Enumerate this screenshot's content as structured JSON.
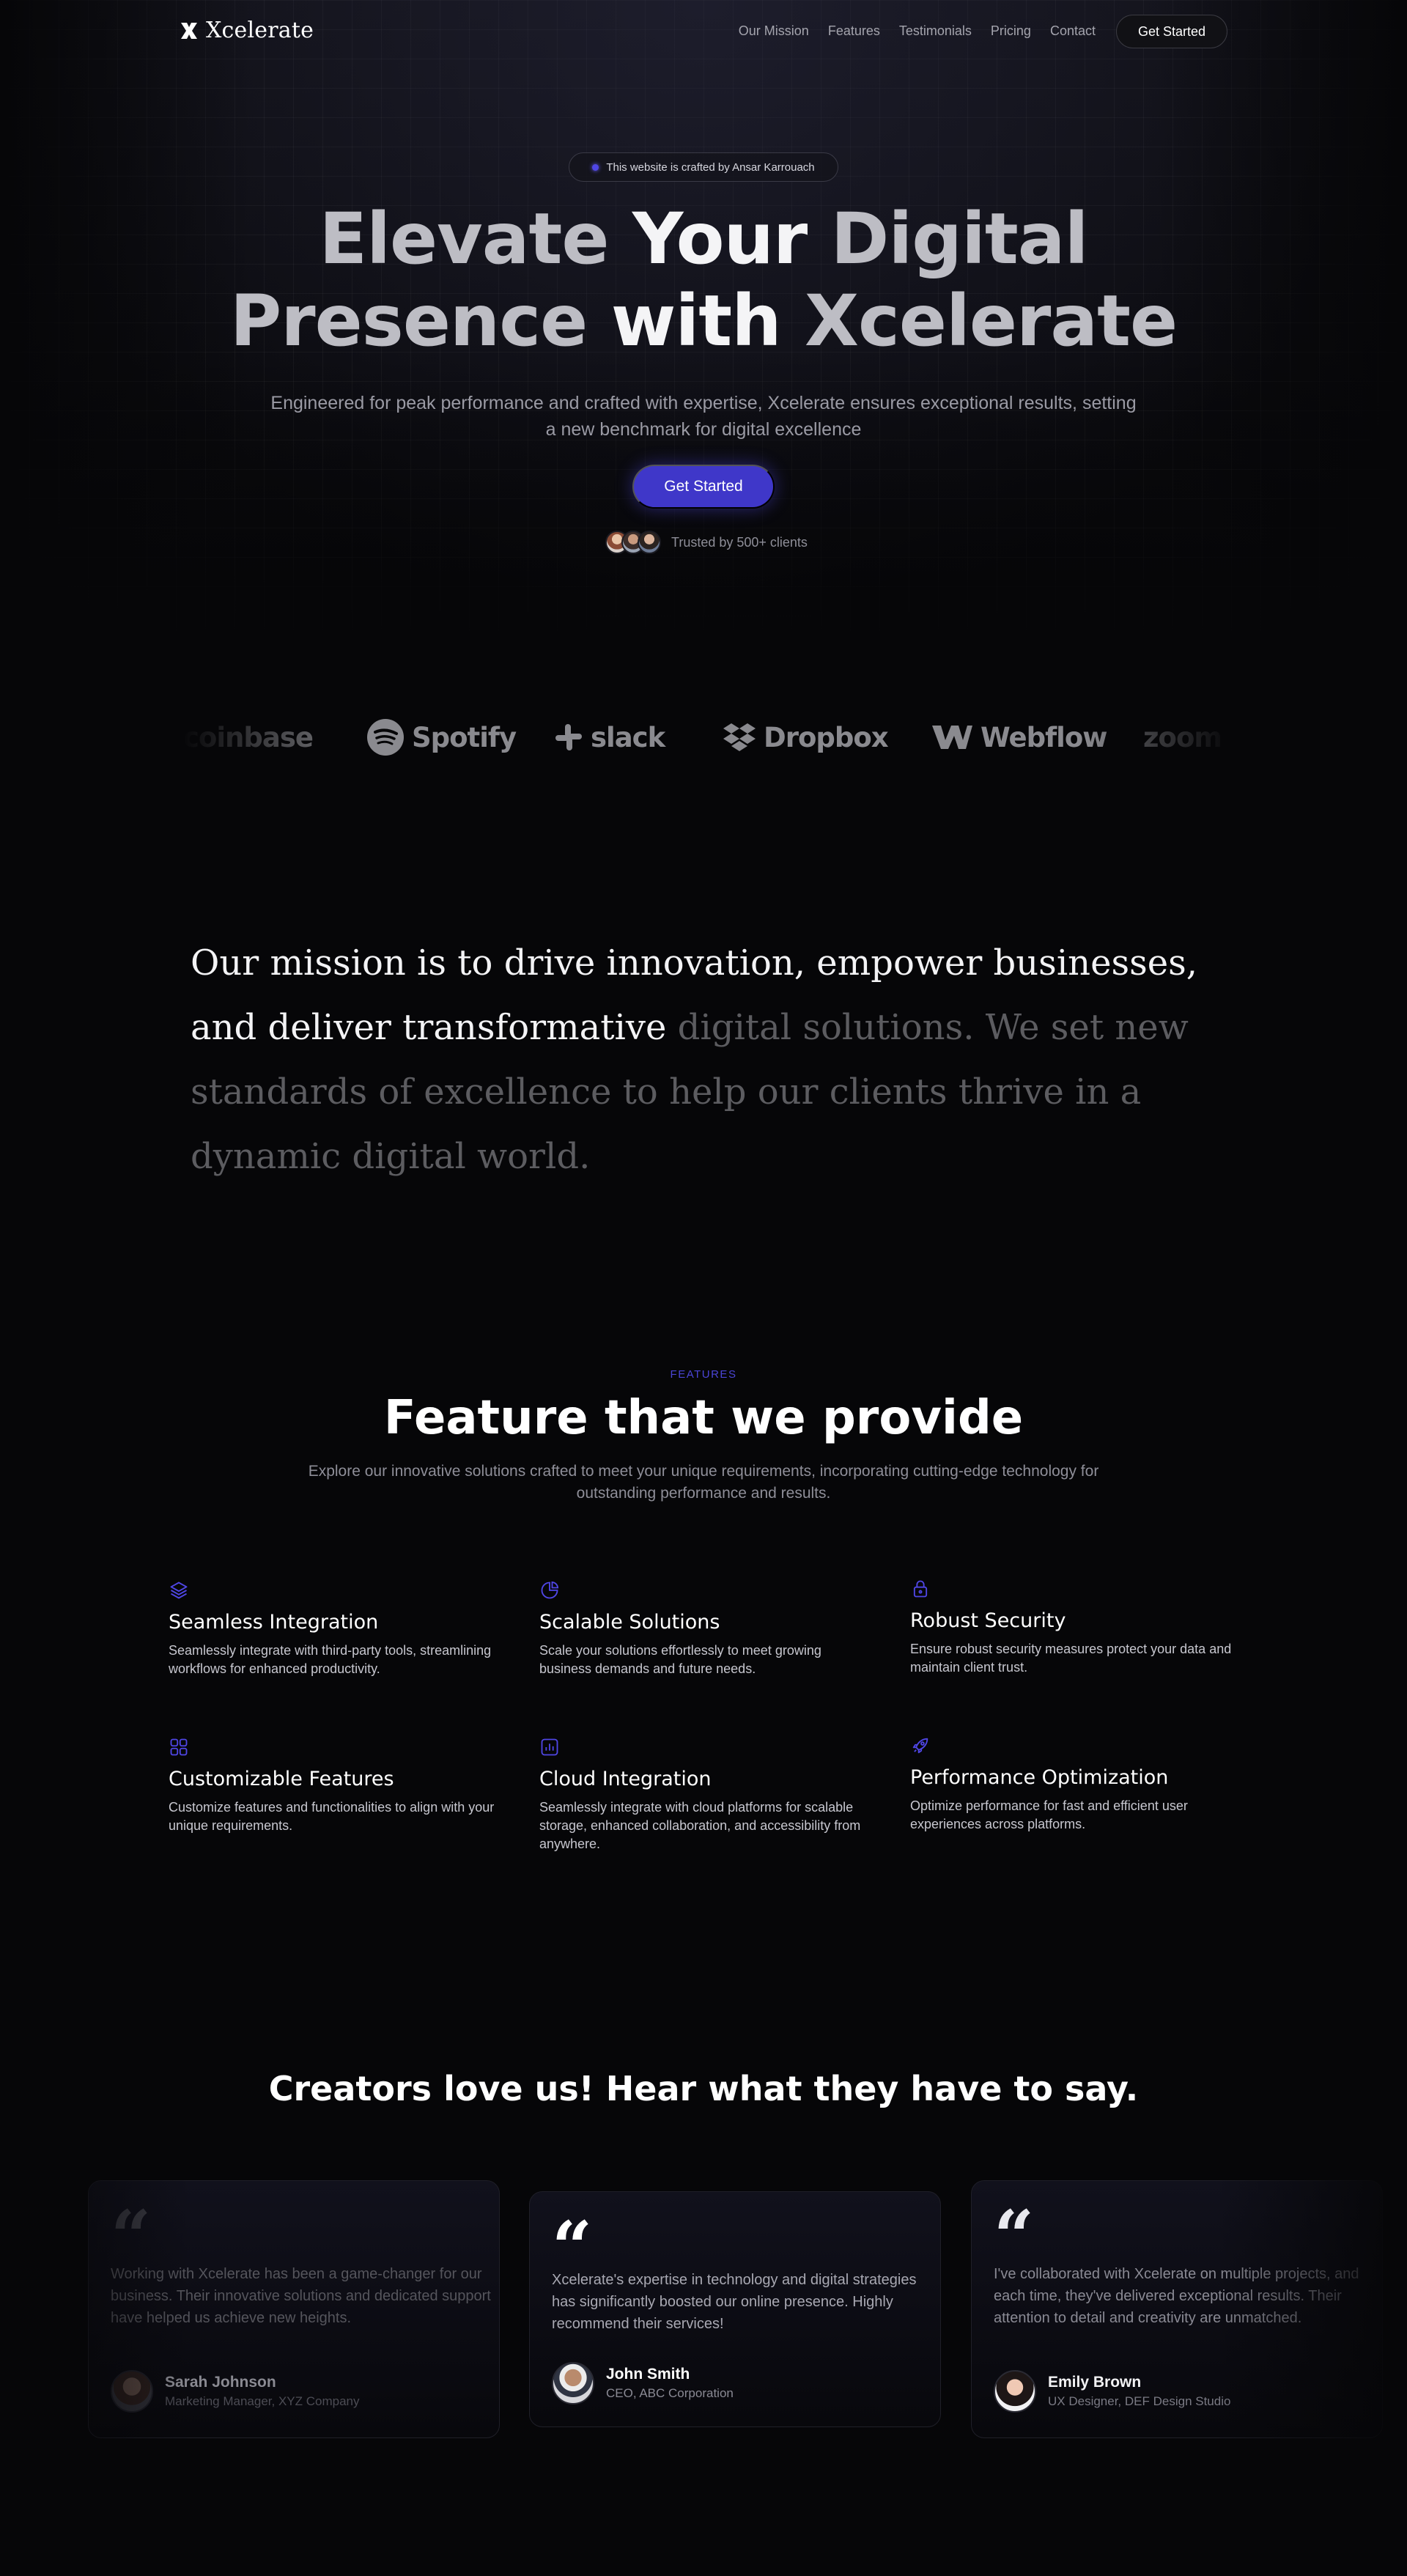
{
  "colors": {
    "accent": "#4f46e5",
    "cta": "#3f37c9",
    "background": "#060608"
  },
  "nav": {
    "brand": "Xcelerate",
    "links": [
      "Our Mission",
      "Features",
      "Testimonials",
      "Pricing",
      "Contact"
    ],
    "cta": "Get Started"
  },
  "hero": {
    "badge": "This website is crafted by Ansar Karrouach",
    "title_line1_a": "Elevate ",
    "title_line1_b": "Your ",
    "title_line1_c": "Digital",
    "title_line2_a": "Presence ",
    "title_line2_b": "with ",
    "title_line2_c": "Xcelerate",
    "subtitle": "Engineered for peak performance and crafted with expertise, Xcelerate ensures exceptional results, setting a new benchmark for digital excellence",
    "cta": "Get Started",
    "trust": "Trusted by 500+ clients"
  },
  "logos": [
    "coinbase",
    "Spotify",
    "slack",
    "Dropbox",
    "Webflow",
    "zoom"
  ],
  "mission": {
    "bright": "Our mission is to drive innovation, empower businesses, and deliver transformative ",
    "dim": "digital solutions. We set new standards of excellence to help our clients thrive in a dynamic digital world."
  },
  "features": {
    "eyebrow": "FEATURES",
    "title": "Feature that we provide",
    "subtitle": "Explore our innovative solutions crafted to meet your unique requirements, incorporating cutting-edge technology for outstanding performance and results.",
    "items": [
      {
        "icon": "layers-icon",
        "title": "Seamless Integration",
        "desc": "Seamlessly integrate with third-party tools, streamlining workflows for enhanced productivity."
      },
      {
        "icon": "chart-pie-icon",
        "title": "Scalable Solutions",
        "desc": "Scale your solutions effortlessly to meet growing business demands and future needs."
      },
      {
        "icon": "lock-icon",
        "title": "Robust Security",
        "desc": "Ensure robust security measures protect your data and maintain client trust."
      },
      {
        "icon": "grid-icon",
        "title": "Customizable Features",
        "desc": "Customize features and functionalities to align with your unique requirements."
      },
      {
        "icon": "bar-chart-icon",
        "title": "Cloud Integration",
        "desc": "Seamlessly integrate with cloud platforms for scalable storage, enhanced collaboration, and accessibility from anywhere."
      },
      {
        "icon": "rocket-icon",
        "title": "Performance Optimization",
        "desc": "Optimize performance for fast and efficient user experiences across platforms."
      }
    ]
  },
  "testimonials": {
    "title": "Creators love us! Hear what they have to say.",
    "items": [
      {
        "quote": "Working with Xcelerate has been a game-changer for our business. Their innovative solutions and dedicated support have helped us achieve new heights.",
        "name": "Sarah Johnson",
        "role": "Marketing Manager, XYZ Company"
      },
      {
        "quote": "Xcelerate's expertise in technology and digital strategies has significantly boosted our online presence. Highly recommend their services!",
        "name": "John Smith",
        "role": "CEO, ABC Corporation"
      },
      {
        "quote": "I've collaborated with Xcelerate on multiple projects, and each time, they've delivered exceptional results. Their attention to detail and creativity are unmatched.",
        "name": "Emily Brown",
        "role": "UX Designer, DEF Design Studio"
      }
    ]
  }
}
